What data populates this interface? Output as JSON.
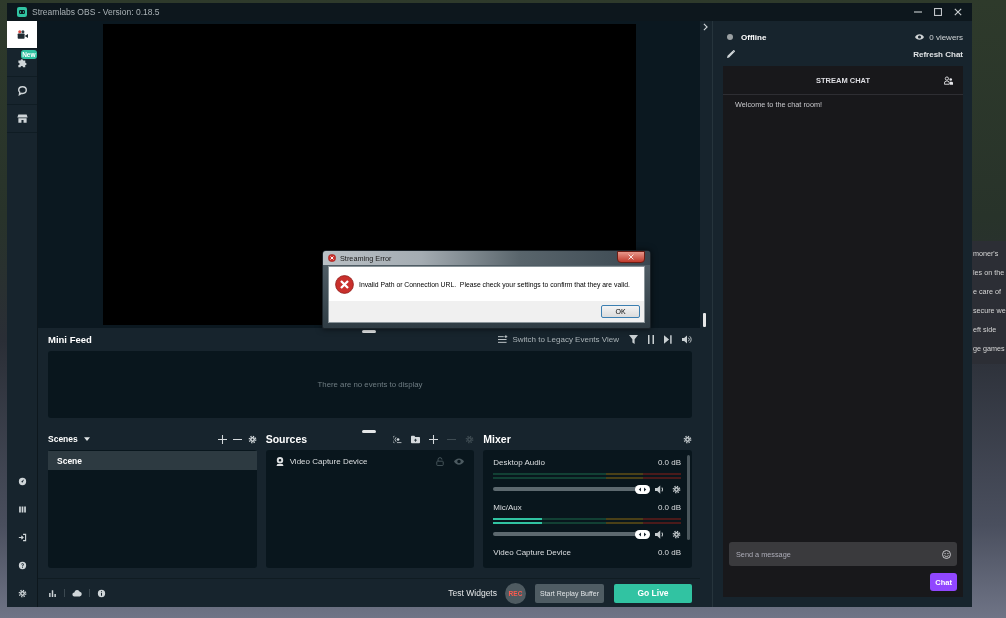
{
  "window": {
    "title": "Streamlabs OBS - Version: 0.18.5"
  },
  "nav": {
    "top": [
      {
        "selected": true
      },
      {
        "selected": false,
        "badge": "New"
      },
      {
        "selected": false
      },
      {
        "selected": false
      }
    ]
  },
  "mini_feed": {
    "title": "Mini Feed",
    "legacy_link": "Switch to Legacy Events View",
    "empty_text": "There are no events to display"
  },
  "scenes": {
    "title": "Scenes",
    "tools": [
      {
        "disabled": false
      },
      {
        "disabled": false
      },
      {
        "disabled": false
      }
    ],
    "items": [
      {
        "name": "Scene",
        "selected": true
      }
    ]
  },
  "sources": {
    "title": "Sources",
    "tools": [
      {
        "disabled": false
      },
      {
        "disabled": false
      },
      {
        "disabled": false
      },
      {
        "disabled": true
      },
      {
        "disabled": true
      }
    ],
    "items": [
      {
        "name": "Video Capture Device",
        "selected": false
      }
    ]
  },
  "mixer": {
    "title": "Mixer",
    "items": [
      {
        "name": "Desktop Audio",
        "reading": "0.0 dB",
        "volume": {
          "level": 1
        }
      },
      {
        "name": "Mic/Aux",
        "reading": "0.0 dB",
        "meter": {
          "level": 0.26
        },
        "volume": {
          "level": 1
        }
      },
      {
        "name": "Video Capture Device",
        "reading": "0.0 dB"
      }
    ]
  },
  "footer": {
    "test_widgets": "Test Widgets",
    "record": "REC",
    "replay_buffer": "Start Replay Buffer",
    "go_live": "Go Live"
  },
  "chat_panel": {
    "status": {
      "label": "Offline",
      "live": false
    },
    "viewers": "0 viewers",
    "refresh": "Refresh Chat",
    "chat": {
      "title": "STREAM CHAT",
      "messages": [
        "Welcome to the chat room!"
      ],
      "input": {
        "placeholder": "Send a message"
      },
      "button": "Chat"
    }
  },
  "dialog": {
    "title": "Streaming Error",
    "message": "Invalid Path or Connection URL.  Please check your settings to confirm that they are valid.",
    "buttons": [
      "OK"
    ]
  },
  "background_window": {
    "lines": [
      "moner's",
      "les on the",
      "e care of",
      "secure we",
      "eft side",
      "ge games"
    ]
  }
}
